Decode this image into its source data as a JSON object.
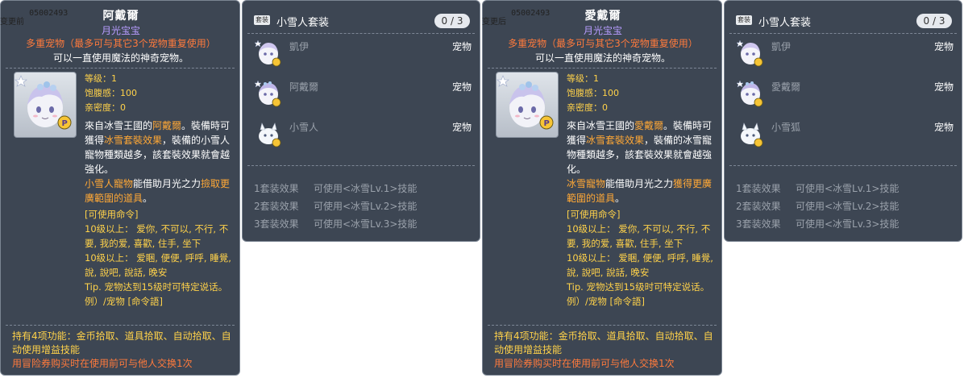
{
  "groups": [
    {
      "tag": "05002493\n变更前",
      "pet": {
        "title": "阿戴爾",
        "category": "月光宝宝",
        "multi_pet": "多重宠物（最多可与其它3个宠物重复使用）",
        "magic": "可以一直使用魔法的神奇宠物。",
        "level_label": "等级：",
        "level": "1",
        "fullness_label": "饱腹感：",
        "fullness": "100",
        "closeness_label": "亲密度：",
        "closeness": "0",
        "desc1": "來自冰雪王國的",
        "desc1_hl": "阿戴爾",
        "desc2": "。裝備時可獲得",
        "desc2_hl": "冰雪套裝效果",
        "desc3": "，裝備的小雪人寵物種類越多，該套裝效果就會越強化。",
        "ability_hl1": "小雪人寵物",
        "ability_mid": "能借助月光之力",
        "ability_hl2": "撿取更廣範圍的道具",
        "ability_end": "。",
        "cmd_header": "[可使用命令]",
        "cmd1": "10级以上： 爱你, 不可以, 不行, 不要, 我的爱, 喜歡, 住手, 坐下",
        "cmd2": "10级以上： 爱睏, 便便, 呼呼, 睡覺, 說, 說吧, 說話, 晚安",
        "tip": "Tip. 宠物达到15级时可特定说话。",
        "example": "例）/宠物 [命令語]",
        "foot1": "持有4项功能：金币拾取、道具拾取、自动拾取、自动使用增益技能",
        "foot2": "用冒险券购买时在使用前可与他人交换1次"
      },
      "set": {
        "badge": "套装",
        "name": "小雪人套装",
        "count": "0 / 3",
        "members": [
          {
            "name": "凱伊",
            "type": "宠物",
            "icon": "kai-pet-icon"
          },
          {
            "name": "阿戴爾",
            "type": "宠物",
            "icon": "adel-pet-icon"
          },
          {
            "name": "小雪人",
            "type": "宠物",
            "icon": "snowman-pet-icon"
          }
        ],
        "effects": [
          {
            "label": "1套装效果",
            "value": "可使用<冰雪Lv.1>技能"
          },
          {
            "label": "2套装效果",
            "value": "可使用<冰雪Lv.2>技能"
          },
          {
            "label": "3套装效果",
            "value": "可使用<冰雪Lv.3>技能"
          }
        ]
      }
    },
    {
      "tag": "05002493\n变更后",
      "pet": {
        "title": "愛戴爾",
        "category": "月光宝宝",
        "multi_pet": "多重宠物（最多可与其它3个宠物重复使用）",
        "magic": "可以一直使用魔法的神奇宠物。",
        "level_label": "等级：",
        "level": "1",
        "fullness_label": "饱腹感：",
        "fullness": "100",
        "closeness_label": "亲密度：",
        "closeness": "0",
        "desc1": "來自冰雪王國的",
        "desc1_hl": "愛戴爾",
        "desc2": "。裝備時可獲得",
        "desc2_hl": "冰雪套裝效果",
        "desc3": "，裝備的冰雪寵物種類越多，該套裝效果就會越強化。",
        "ability_hl1": "冰雪寵物",
        "ability_mid": "能借助月光之力",
        "ability_hl2": "獲得更廣範圍的道具",
        "ability_end": "。",
        "cmd_header": "[可使用命令]",
        "cmd1": "10级以上： 爱你, 不可以, 不行, 不要, 我的爱, 喜歡, 住手, 坐下",
        "cmd2": "10级以上： 爱睏, 便便, 呼呼, 睡覺, 說, 說吧, 說話, 晚安",
        "tip": "Tip. 宠物达到15级时可特定说话。",
        "example": "例）/宠物 [命令語]",
        "foot1": "持有4项功能：金币拾取、道具拾取、自动拾取、自动使用增益技能",
        "foot2": "用冒险券购买时在使用前可与他人交换1次"
      },
      "set": {
        "badge": "套装",
        "name": "小雪人套装",
        "count": "0 / 3",
        "members": [
          {
            "name": "凱伊",
            "type": "宠物",
            "icon": "kai-pet-icon"
          },
          {
            "name": "愛戴爾",
            "type": "宠物",
            "icon": "adel-pet-icon"
          },
          {
            "name": "小雪狐",
            "type": "宠物",
            "icon": "snow-fox-pet-icon"
          }
        ],
        "effects": [
          {
            "label": "1套装效果",
            "value": "可使用<冰雪Lv.1>技能"
          },
          {
            "label": "2套装效果",
            "value": "可使用<冰雪Lv.2>技能"
          },
          {
            "label": "3套装效果",
            "value": "可使用<冰雪Lv.3>技能"
          }
        ]
      }
    }
  ]
}
